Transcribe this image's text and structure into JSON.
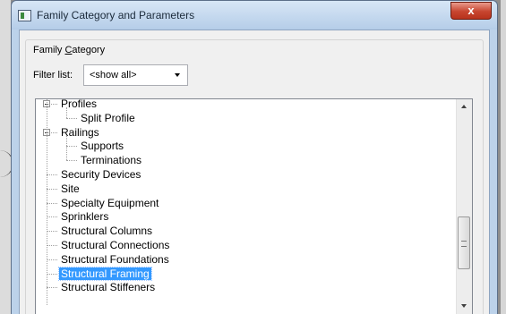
{
  "window": {
    "title": "Family Category and Parameters",
    "close_label": "x"
  },
  "group": {
    "title_prefix": "Family ",
    "title_accel": "C",
    "title_suffix": "ategory"
  },
  "filter": {
    "label": "Filter list:",
    "value": "<show all>"
  },
  "tree": {
    "items": [
      {
        "label": "Profiles",
        "level": 0,
        "expander": true
      },
      {
        "label": "Split Profile",
        "level": 1
      },
      {
        "label": "Railings",
        "level": 0,
        "expander": true
      },
      {
        "label": "Supports",
        "level": 1
      },
      {
        "label": "Terminations",
        "level": 1
      },
      {
        "label": "Security Devices",
        "level": 0
      },
      {
        "label": "Site",
        "level": 0
      },
      {
        "label": "Specialty Equipment",
        "level": 0
      },
      {
        "label": "Sprinklers",
        "level": 0
      },
      {
        "label": "Structural Columns",
        "level": 0
      },
      {
        "label": "Structural Connections",
        "level": 0
      },
      {
        "label": "Structural Foundations",
        "level": 0
      },
      {
        "label": "Structural Framing",
        "level": 0,
        "selected": true
      },
      {
        "label": "Structural Stiffeners",
        "level": 0
      }
    ]
  },
  "colors": {
    "selection": "#3399ff",
    "titlebar": "#c7d9ee",
    "close": "#c7452f"
  }
}
